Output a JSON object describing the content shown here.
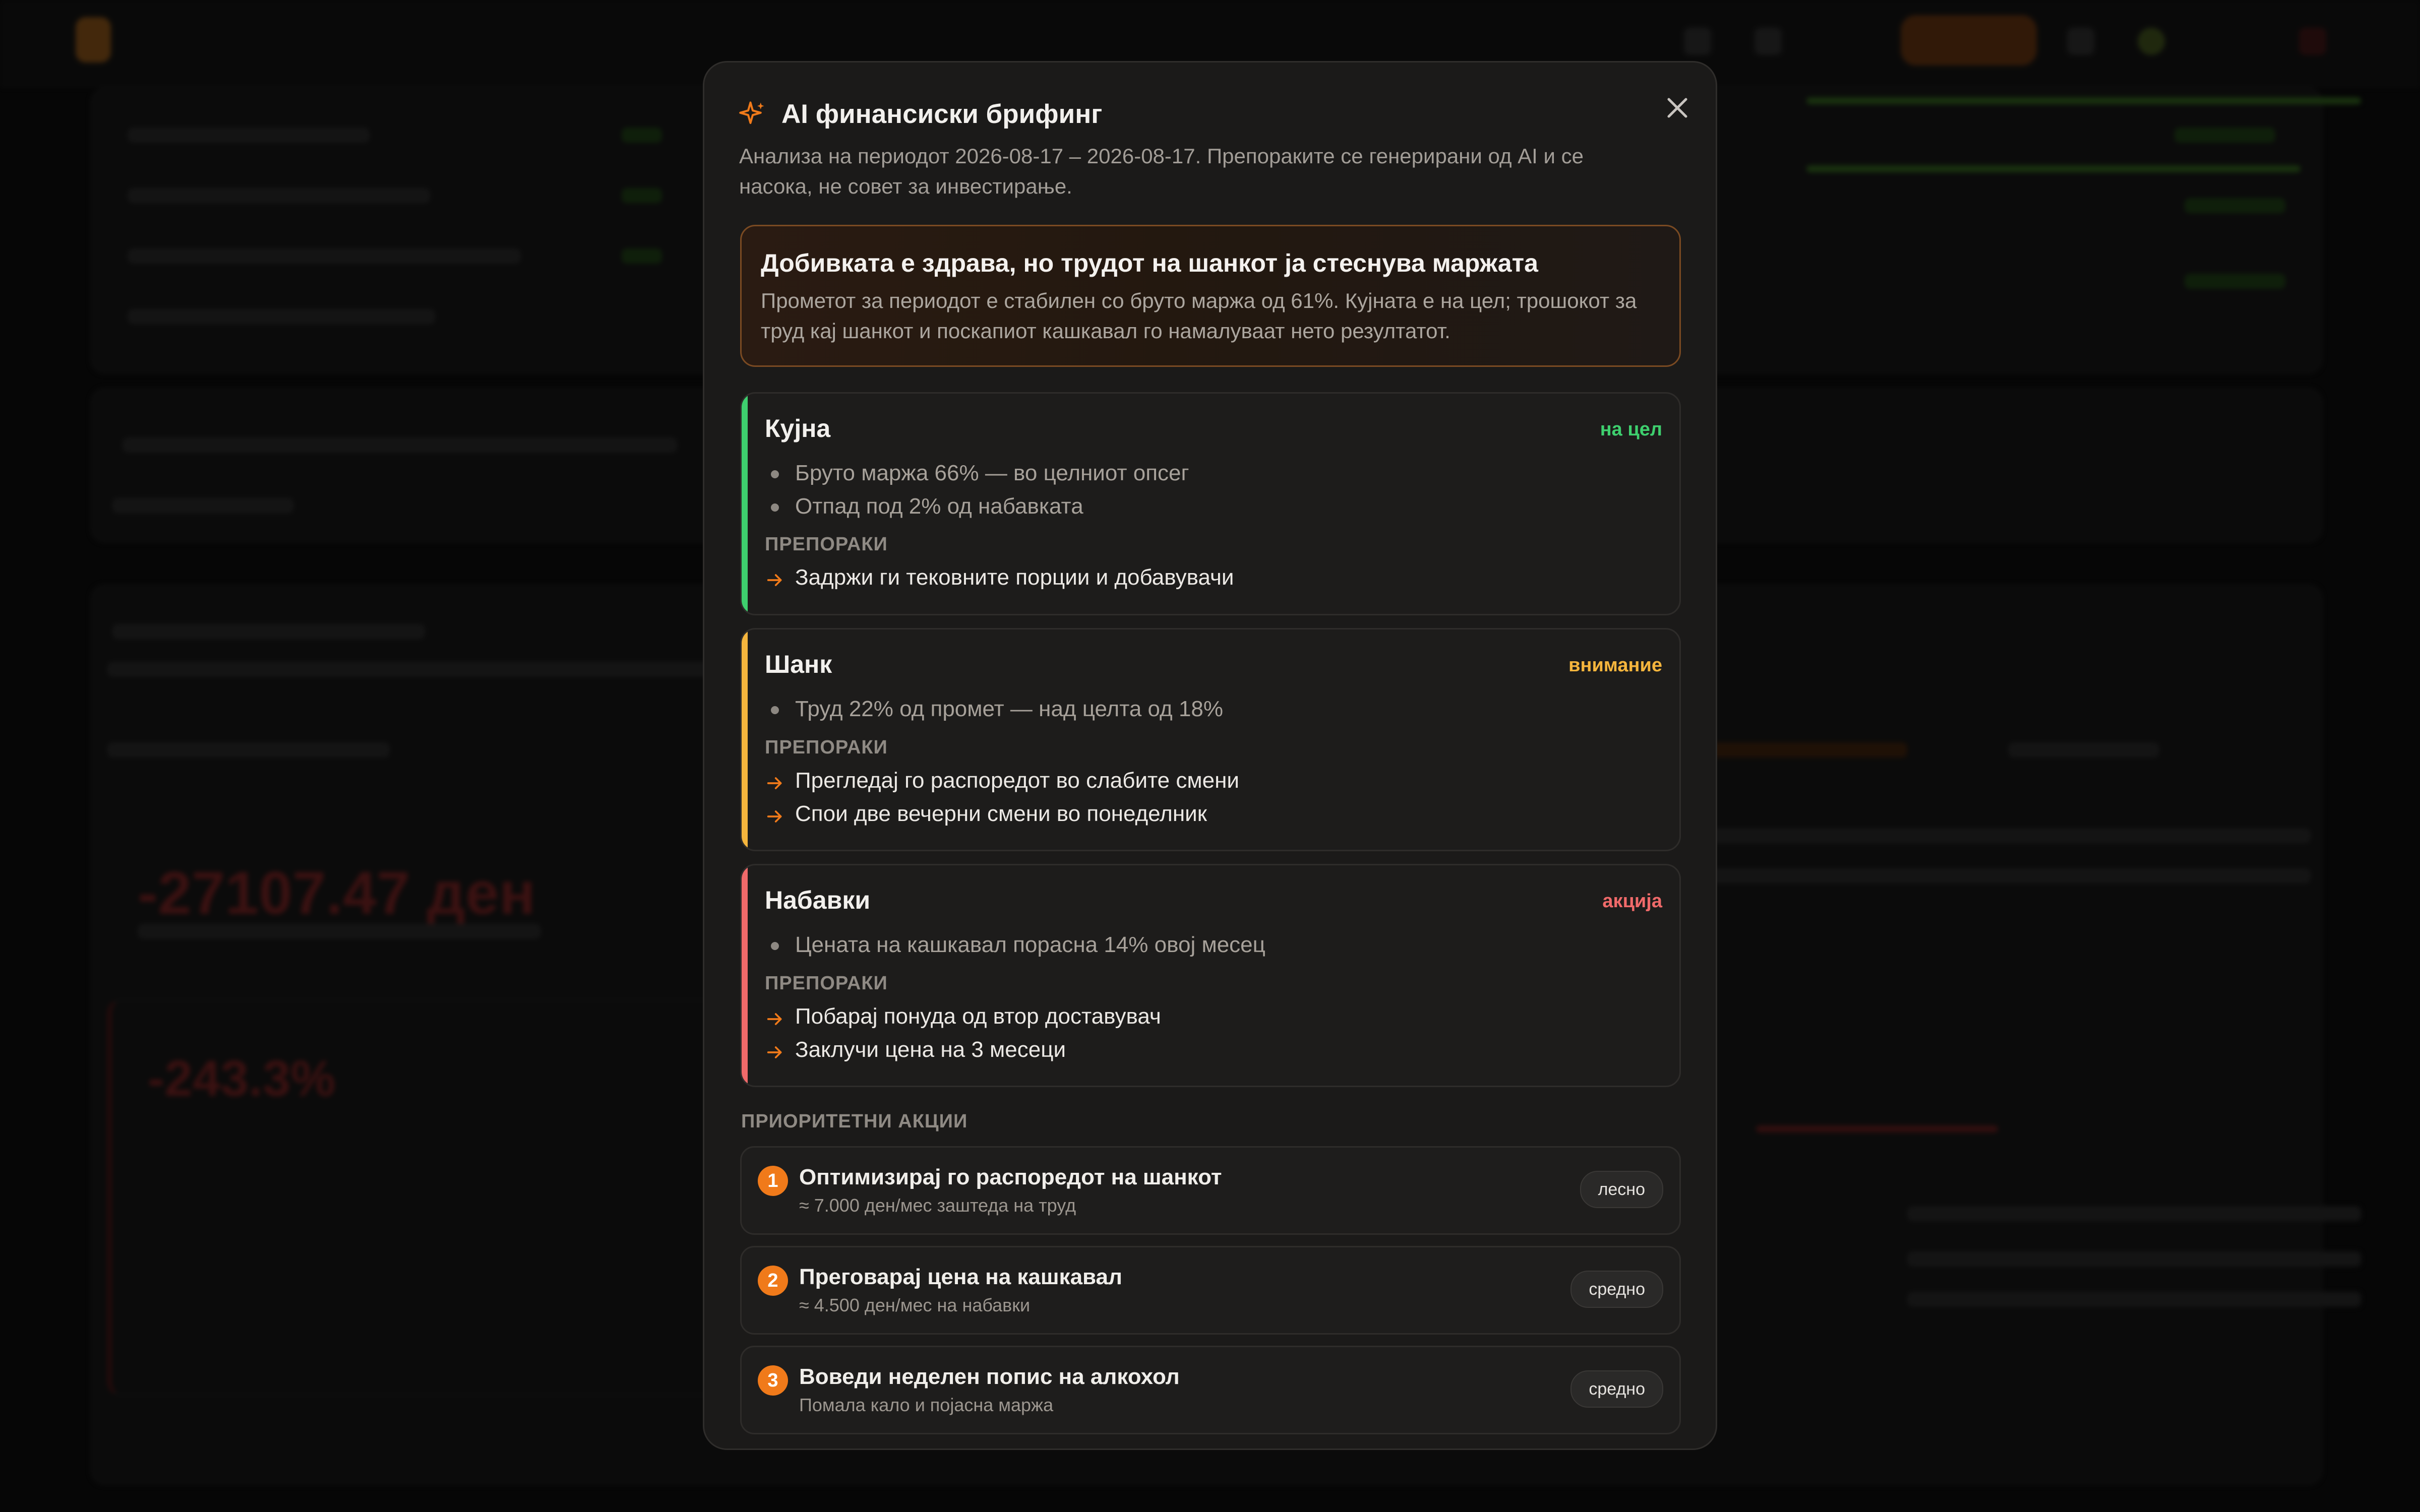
{
  "modal": {
    "title": "AI финансиски брифинг",
    "subtitle": "Анализа на периодот 2026-08-17 – 2026-08-17. Препораките се генерирани од AI и се насока, не совет за инвестирање.",
    "summary": {
      "headline": "Добивката е здрава, но трудот на шанкот ја стеснува маржата",
      "text": "Прометот за периодот е стабилен со бруто маржа од 61%. Кујната е на цел; трошокот за труд кај шанкот и поскапиот кашкавал го намалуваат нето резултатот."
    },
    "recommendations_label": "ПРЕПОРАКИ",
    "sections": [
      {
        "name": "Кујна",
        "status": "на цел",
        "status_color": "#3ecf6e",
        "accent": "#3ecf6e",
        "points": [
          "Бруто маржа 66% — во целниот опсег",
          "Отпад под 2% од набавката"
        ],
        "recommendations": [
          "Задржи ги тековните порции и добавувачи"
        ]
      },
      {
        "name": "Шанк",
        "status": "внимание",
        "status_color": "#f5b53d",
        "accent": "#f5b53d",
        "points": [
          "Труд 22% од промет — над целта од 18%"
        ],
        "recommendations": [
          "Прегледај го распоредот во слабите смени",
          "Спои две вечерни смени во понеделник"
        ]
      },
      {
        "name": "Набавки",
        "status": "акција",
        "status_color": "#f06a6a",
        "accent": "#f06a6a",
        "points": [
          "Цената на кашкавал порасна 14% овој месец"
        ],
        "recommendations": [
          "Побарај понуда од втор доставувач",
          "Заклучи цена на 3 месеци"
        ]
      }
    ],
    "priority_label": "ПРИОРИТЕТНИ АКЦИИ",
    "actions": [
      {
        "num": "1",
        "title": "Оптимизирај го распоредот на шанкот",
        "sub": "≈ 7.000 ден/мес заштеда на труд",
        "badge": "лесно"
      },
      {
        "num": "2",
        "title": "Преговарај цена на кашкавал",
        "sub": "≈ 4.500 ден/мес на набавки",
        "badge": "средно"
      },
      {
        "num": "3",
        "title": "Воведи неделен попис на алкохол",
        "sub": "Помала кало и појасна маржа",
        "badge": "средно"
      }
    ]
  },
  "colors": {
    "accent": "#f07a1a",
    "danger": "#6b2020"
  },
  "icons": {
    "title": "sparkle-icon",
    "close": "close-icon",
    "arrow": "arrow-right-icon"
  }
}
